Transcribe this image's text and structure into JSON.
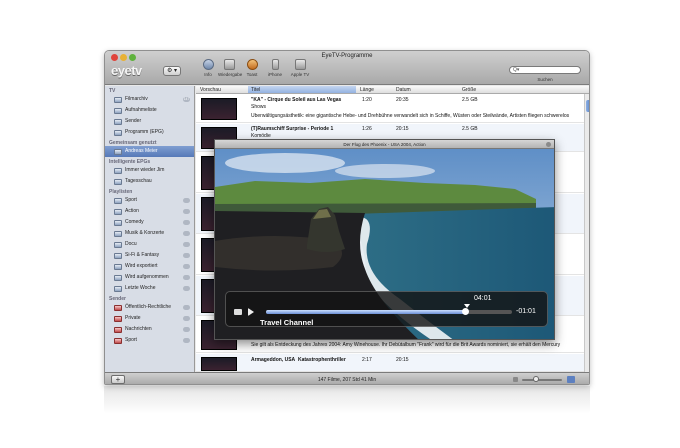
{
  "window": {
    "title": "EyeTV-Programme"
  },
  "toolbar": {
    "logo": "eyetv",
    "gear_label": "⚙ ▾",
    "tools": [
      {
        "label": "Info",
        "icon": "info-icon"
      },
      {
        "label": "Wiedergabe",
        "icon": "play-icon"
      },
      {
        "label": "Toast",
        "icon": "toast-icon"
      },
      {
        "label": "iPhone",
        "icon": "iphone-icon"
      },
      {
        "label": "Apple TV",
        "icon": "appletv-icon"
      }
    ],
    "search_placeholder": "Q▾",
    "search_label": "Suchen"
  },
  "sidebar": {
    "groups": [
      {
        "title": "TV",
        "items": [
          {
            "label": "Filmarchiv",
            "badge": "147"
          },
          {
            "label": "Aufnahmeliste",
            "badge": ""
          },
          {
            "label": "Sender",
            "badge": ""
          },
          {
            "label": "Programm (EPG)",
            "badge": ""
          }
        ]
      },
      {
        "title": "Gemeinsam genutzt",
        "items": [
          {
            "label": "Andreas Meier",
            "badge": "",
            "selected": true
          }
        ]
      },
      {
        "title": "Intelligente EPGs",
        "items": [
          {
            "label": "Immer wieder Jim",
            "badge": ""
          },
          {
            "label": "Tagesschau",
            "badge": ""
          }
        ]
      },
      {
        "title": "Playlisten",
        "items": [
          {
            "label": "Sport",
            "badge": ""
          },
          {
            "label": "Action",
            "badge": ""
          },
          {
            "label": "Comedy",
            "badge": ""
          },
          {
            "label": "Musik & Konzerte",
            "badge": ""
          },
          {
            "label": "Docu",
            "badge": ""
          },
          {
            "label": "Si-Fi & Fantasy",
            "badge": ""
          },
          {
            "label": "Wird exportiert",
            "badge": ""
          },
          {
            "label": "Wird aufgenommen",
            "badge": ""
          },
          {
            "label": "Letzte Woche",
            "badge": ""
          }
        ]
      },
      {
        "title": "Sender",
        "items": [
          {
            "label": "Öffentlich-Rechtliche",
            "badge": ""
          },
          {
            "label": "Private",
            "badge": ""
          },
          {
            "label": "Nachrichten",
            "badge": ""
          },
          {
            "label": "Sport",
            "badge": ""
          }
        ]
      }
    ]
  },
  "list": {
    "columns": [
      "Vorschau",
      "Titel",
      "Länge",
      "Datum",
      "Größe"
    ],
    "rows": [
      {
        "title": "\"KÀ\" - Cirque du Soleil aus Las Vegas",
        "genre": "Shows",
        "length": "1:20",
        "date": "20:35",
        "size": "2.5 GB",
        "desc": "Überwältigungsästhetik: eine gigantische Hebe- und Drehbühne verwandelt sich in Schiffe, Wüsten oder Steilwände, Artisten fliegen schwerelos"
      },
      {
        "title": "(T)Raumschiff Surprise - Periode 1",
        "genre": "Komödie",
        "length": "1:26",
        "date": "20:15",
        "size": "2.5 GB",
        "desc": ""
      },
      {
        "title": "",
        "genre": "",
        "length": "",
        "date": "",
        "size": "",
        "desc": "Sie gilt als Entdeckung des Jahres 2004: Amy Winehouse. Ihr Debütalbum \"Frank\" wird für die Brit Awards nominiert, sie erhält den Mercury"
      },
      {
        "title": "Armageddon, USA",
        "genre": "Katastrophenthriller",
        "length": "2:17",
        "date": "20:15",
        "size": "",
        "desc": ""
      }
    ]
  },
  "status": {
    "text": "147 Filme, 207 Std 41 Min"
  },
  "player": {
    "title": "Der Flug des Phoenix - USA 2004, Action",
    "elapsed": "04:01",
    "remaining": "-01:01",
    "progress": 0.81,
    "channel": "Travel Channel"
  },
  "colors": {
    "selection": "#5679b8",
    "sidebar_bg": "#d8dde6"
  }
}
